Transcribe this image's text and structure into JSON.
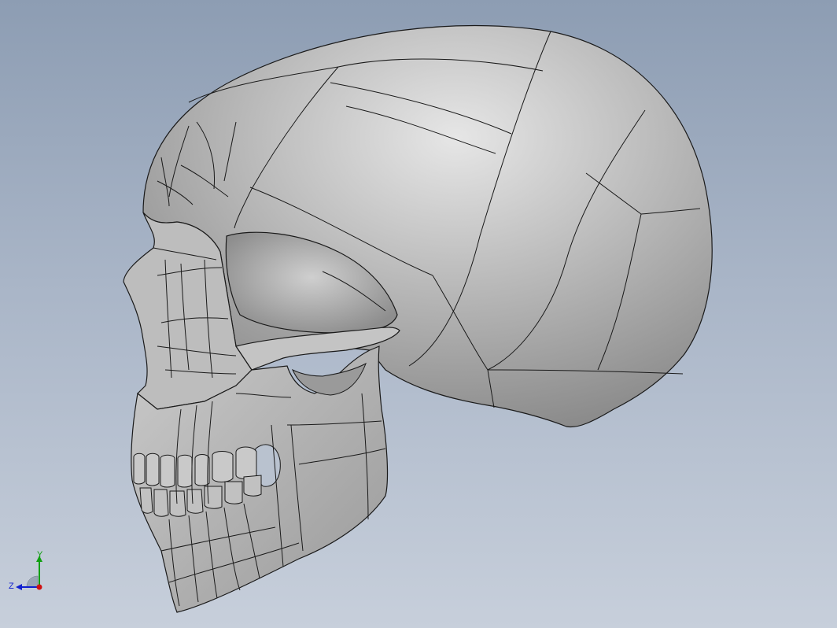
{
  "viewport": {
    "model": "skull-side-view",
    "background_top": "#8d9db3",
    "background_bottom": "#c7cfdb",
    "model_color": "#b4b4b4",
    "edge_color": "#1a1a1a"
  },
  "triad": {
    "x_color": "#d01010",
    "y_color": "#10a010",
    "z_color": "#1020d0",
    "y_label": "Y",
    "z_label": "Z"
  }
}
